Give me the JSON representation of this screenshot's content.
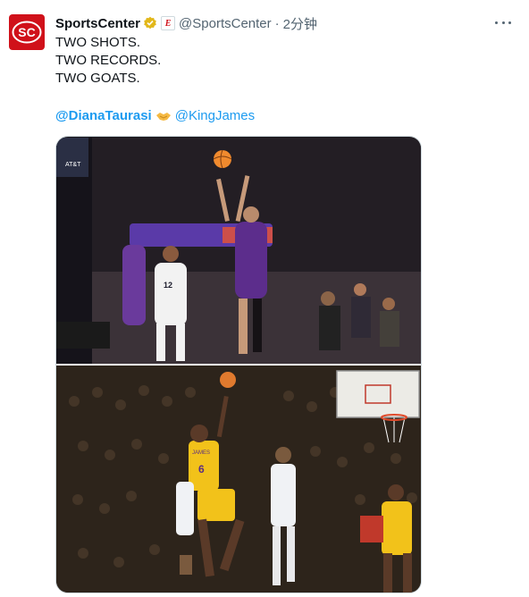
{
  "account": {
    "display_name": "SportsCenter",
    "handle": "@SportsCenter",
    "separator": "·",
    "time": "2分钟",
    "logo_text": "SC",
    "affiliate_badge": "E"
  },
  "tweet": {
    "lines": [
      "TWO SHOTS.",
      "TWO RECORDS.",
      "TWO GOATS."
    ],
    "mention_1": "@DianaTaurasi",
    "mention_2": "@KingJames"
  },
  "photo_top": {
    "jersey_left": "12",
    "arena_text": "AT&T"
  },
  "photo_bottom": {
    "jersey_number": "6",
    "jersey_name": "JAMES"
  },
  "colors": {
    "brand_red": "#d0111a",
    "link_blue": "#1d9bf0",
    "verified_gold": "#e2b719",
    "secondary_text": "#536471"
  },
  "icons": [
    "sc-logo-icon",
    "verified-badge-icon",
    "espn-affiliate-icon",
    "more-icon",
    "handshake-icon"
  ]
}
